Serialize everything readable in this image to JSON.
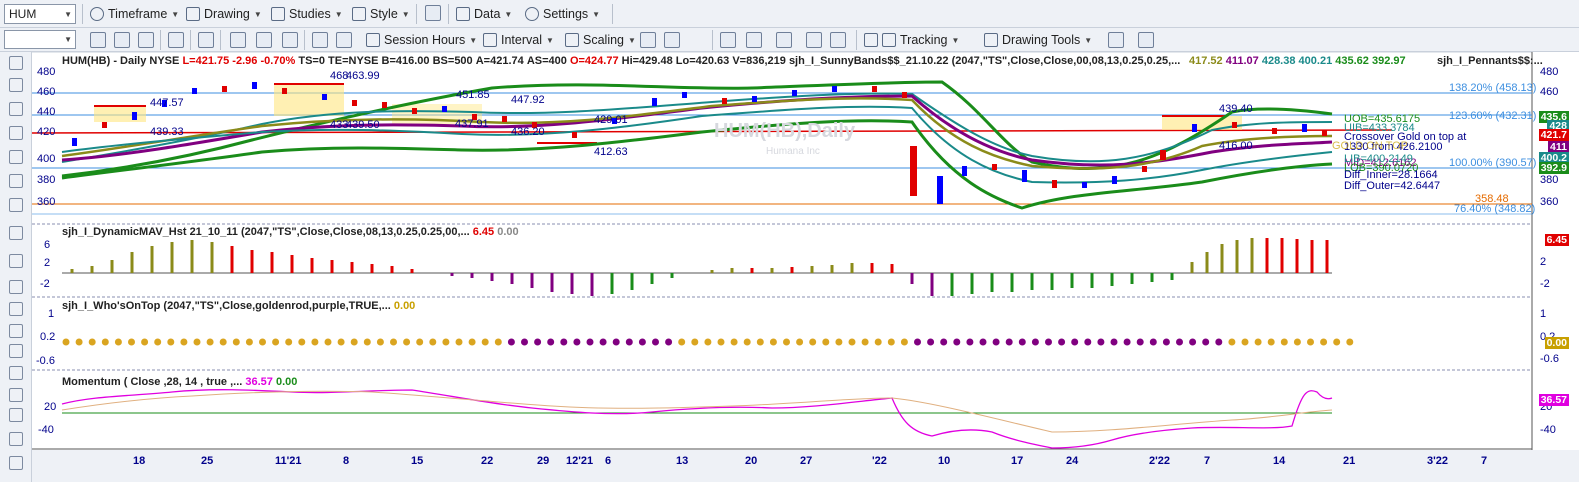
{
  "toolbar": {
    "symbol": "HUM",
    "timeframe": "Timeframe",
    "drawing": "Drawing",
    "studies": "Studies",
    "style": "Style",
    "data": "Data",
    "settings": "Settings",
    "session_hours": "Session Hours",
    "interval": "Interval",
    "scaling": "Scaling",
    "tracking": "Tracking",
    "drawing_tools": "Drawing Tools"
  },
  "header": {
    "symbol": "HUM(HB) - Daily",
    "exchange": "NYSE",
    "last": "L=421.75",
    "change": "-2.96",
    "change_pct": "-0.70%",
    "ts": "TS=0",
    "te": "TE=NYSE",
    "bid": "B=416.00",
    "bs": "BS=500",
    "ask": "A=421.74",
    "as": "AS=400",
    "open": "O=424.77",
    "high": "Hi=429.48",
    "low": "Lo=420.63",
    "volume": "V=836,219",
    "study": "sjh_I_SunnyBands$$_21.10.22 (2047,\"TS\",Close,Close,00,08,13,0.25,0.25,...",
    "sv1": "417.52",
    "sv2": "411.07",
    "sv3": "428.38",
    "sv4": "400.21",
    "sv5": "435.62",
    "sv6": "392.97",
    "pennants": "sjh_I_Pennants$$:..."
  },
  "watermark": {
    "title": "HUM(HB),Daily",
    "subtitle": "Humana Inc"
  },
  "price_labels": {
    "p1": "447.57",
    "p2": "439.33",
    "p3": "463.99",
    "p3b": "468",
    "p4": "439.50",
    "p4b": "433",
    "p5": "451.85",
    "p6": "447.92",
    "p7": "437.91",
    "p8": "436.20",
    "p9": "429.01",
    "p10": "412.63",
    "p11": "439.40",
    "p12": "416.00",
    "p13": "358.48"
  },
  "fib": [
    {
      "label": "138.20% (458.13)"
    },
    {
      "label": "123.60% (432.31)"
    },
    {
      "label": "100.00% (390.57)"
    },
    {
      "label": "76.40% (348.82)"
    }
  ],
  "annotations": {
    "uob": "UOB=435.6175",
    "uib": "UIB=433.3784",
    "crossover": "Crossover Gold on top at",
    "bars_from": "1330 from 426.2100",
    "gold_on_top": "GOLD ON TOP",
    "mid": "MID=412.6162",
    "lib": "LIB=400.2149",
    "lob": "LOB=390.0720",
    "diff_inner": "Diff_Inner=28.1664",
    "diff_outer": "Diff_Outer=42.6447"
  },
  "price_axis": [
    "480",
    "460",
    "440",
    "420",
    "400",
    "380",
    "360"
  ],
  "price_tags": {
    "t1": "435.6",
    "t2": "428",
    "t3": "421.7",
    "t4": "411",
    "t5": "400.2",
    "t6": "392.9"
  },
  "panel2": {
    "title": "sjh_I_DynamicMAV_Hst 21_10_11 (2047,\"TS\",Close,Close,08,13,0.25,0.25,00,...",
    "v1": "6.45",
    "v2": "0.00",
    "axis": [
      "6",
      "2",
      "-2"
    ],
    "tag": "6.45"
  },
  "panel3": {
    "title": "sjh_I_Who'sOnTop (2047,\"TS\",Close,goldenrod,purple,TRUE,...",
    "v1": "0.00",
    "axis": [
      "1",
      "0.2",
      "-0.6"
    ],
    "axis_right": [
      "1",
      "0.2",
      "-0.6"
    ],
    "tag": "0.00"
  },
  "panel4": {
    "title": "Momentum ( Close ,28, 14 , true ,...",
    "v1": "36.57",
    "v2": "0.00",
    "axis": [
      "20",
      "-40"
    ],
    "tag": "36.57"
  },
  "x_axis": [
    "18",
    "25",
    "11'21",
    "8",
    "15",
    "22",
    "29",
    "12'21",
    "6",
    "13",
    "20",
    "27",
    "'22",
    "10",
    "17",
    "24",
    "2'22",
    "7",
    "14",
    "21",
    "3'22",
    "7"
  ],
  "colors": {
    "up": "#0000ff",
    "down": "#e00000",
    "band_outer": "#1a8c1a",
    "band_inner": "#1a8a8a",
    "mid": "#800080",
    "gold": "#8b8b1a",
    "fib": "#3d8fe0"
  }
}
